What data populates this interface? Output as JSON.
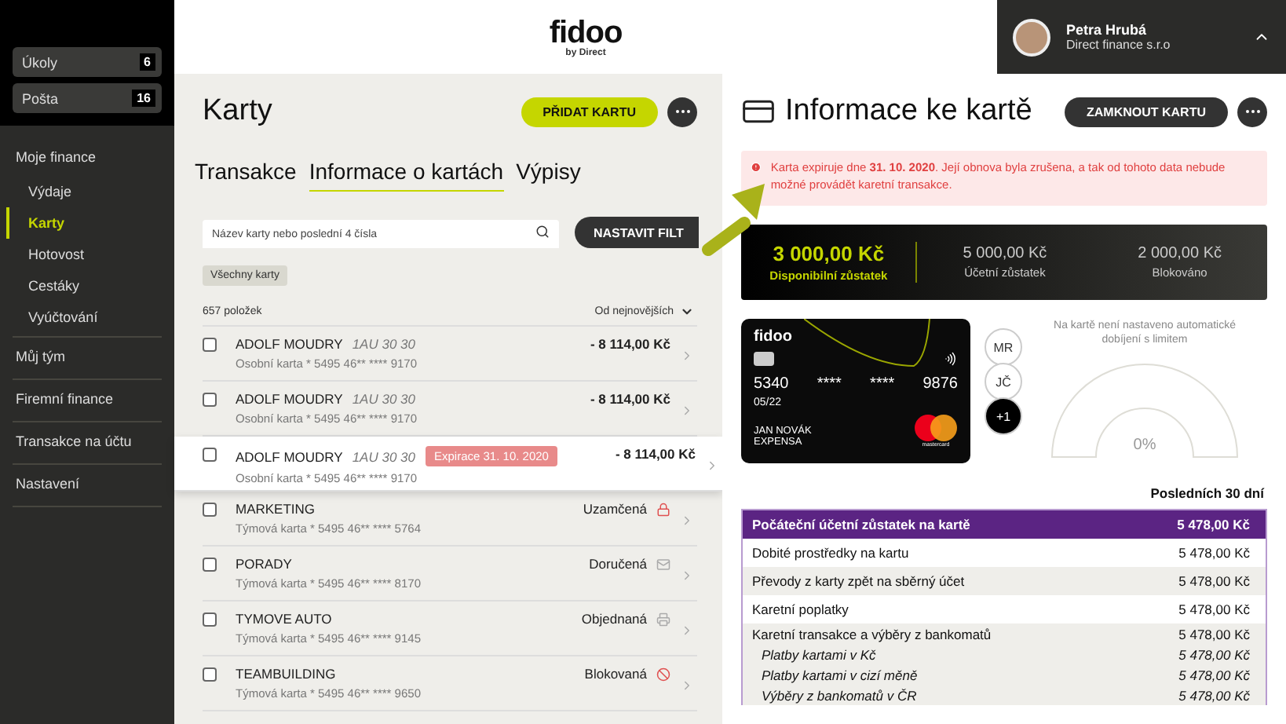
{
  "sidebar": {
    "counters": [
      {
        "label": "Úkoly",
        "count": "6"
      },
      {
        "label": "Pošta",
        "count": "16"
      }
    ],
    "items": [
      {
        "label": "Moje finance",
        "selected": false,
        "children": [
          {
            "label": "Výdaje",
            "selected": false
          },
          {
            "label": "Karty",
            "selected": true
          },
          {
            "label": "Hotovost",
            "selected": false
          },
          {
            "label": "Cestáky",
            "selected": false
          },
          {
            "label": "Vyúčtování",
            "selected": false
          }
        ]
      },
      {
        "label": "Můj tým",
        "selected": false
      },
      {
        "label": "Firemní finance",
        "selected": false
      },
      {
        "label": "Transakce na účtu",
        "selected": false
      },
      {
        "label": "Nastavení",
        "selected": false
      }
    ]
  },
  "header": {
    "logo": "fidoo",
    "logo_sub": "by Direct",
    "user": {
      "name": "Petra Hrubá",
      "company": "Direct finance s.r.o"
    }
  },
  "cards_panel": {
    "title": "Karty",
    "add_button": "PŘIDAT KARTU",
    "tabs": [
      {
        "label": "Transakce",
        "selected": false
      },
      {
        "label": "Informace o kartách",
        "selected": true
      },
      {
        "label": "Výpisy",
        "selected": false
      }
    ],
    "search": {
      "placeholder": "Název karty nebo poslední 4 čísla"
    },
    "filter_button": "NASTAVIT FILT",
    "chip": "Všechny karty",
    "count": "657 položek",
    "sort": "Od nejnovějších",
    "rows": [
      {
        "name": "ADOLF MOUDRY",
        "code": "1AU 30 30",
        "detail": "Osobní karta * 5495 46** **** 9170",
        "value": "- 8 114,00 Kč",
        "kind": "amount",
        "checked": false,
        "selected": false
      },
      {
        "name": "ADOLF MOUDRY",
        "code": "1AU 30 30",
        "detail": "Osobní karta * 5495 46** **** 9170",
        "value": "- 8 114,00 Kč",
        "kind": "amount",
        "checked": false,
        "selected": false
      },
      {
        "name": "ADOLF MOUDRY",
        "code": "1AU 30 30",
        "badge": "Expirace 31. 10. 2020",
        "detail": "Osobní karta * 5495 46** **** 9170",
        "value": "- 8 114,00 Kč",
        "kind": "amount",
        "checked": false,
        "selected": true
      },
      {
        "name": "MARKETING",
        "detail": "Týmová karta * 5495 46** **** 5764",
        "value": "Uzamčená",
        "kind": "locked",
        "checked": false,
        "selected": false
      },
      {
        "name": "PORADY",
        "detail": "Týmová karta * 5495 46** **** 8170",
        "value": "Doručená",
        "kind": "delivered",
        "checked": false,
        "selected": false
      },
      {
        "name": "TYMOVE AUTO",
        "detail": "Týmová karta * 5495 46** **** 9145",
        "value": "Objednaná",
        "kind": "ordered",
        "checked": false,
        "selected": false
      },
      {
        "name": "TEAMBUILDING",
        "detail": "Týmová karta * 5495 46** **** 9650",
        "value": "Blokovaná",
        "kind": "blocked",
        "checked": false,
        "selected": false
      }
    ]
  },
  "detail_panel": {
    "title": "Informace ke kartě",
    "lock_button": "ZAMKNOUT KARTU",
    "alert": "Karta expiruje dne **31. 10. 2020**. Její obnova byla zrušena, a tak od tohoto data nebude možné provádět karetní transakce.",
    "balances": [
      {
        "amount": "3 000,00 Kč",
        "label": "Disponibilní zůstatek",
        "kind": "main"
      },
      {
        "amount": "5 000,00 Kč",
        "label": "Účetní zůstatek",
        "kind": "other"
      },
      {
        "amount": "2 000,00 Kč",
        "label": "Blokováno",
        "kind": "other"
      }
    ],
    "card": {
      "brand": "fidoo",
      "number": [
        "5340",
        "****",
        "****",
        "9876"
      ],
      "expiry": "05/22",
      "holder": "JAN NOVÁK",
      "company": "EXPENSA",
      "network": "mastercard"
    },
    "holders": [
      {
        "label": "MR",
        "kind": "light"
      },
      {
        "label": "JČ",
        "kind": "light"
      },
      {
        "label": "+1",
        "kind": "dark"
      }
    ],
    "topup": {
      "note": "Na kartě není nastaveno automatické dobíjení s limitem",
      "reading": "0%"
    },
    "period": "Posledních 30 dní",
    "table": [
      {
        "label": "Počáteční účetní zůstatek na kartě",
        "value": "5 478,00 Kč",
        "kind": "header"
      },
      {
        "label": "Dobité prostředky na kartu",
        "value": "5 478,00 Kč",
        "kind": "row"
      },
      {
        "label": "Převody z karty zpět na sběrný účet",
        "value": "5 478,00 Kč",
        "kind": "row"
      },
      {
        "label": "Karetní poplatky",
        "value": "5 478,00 Kč",
        "kind": "row"
      },
      {
        "label": "Karetní transakce a výběry z bankomatů",
        "value": "5 478,00 Kč",
        "kind": "group"
      },
      {
        "label": "Platby kartami v Kč",
        "value": "5 478,00 Kč",
        "kind": "sub"
      },
      {
        "label": "Platby kartami v cizí měně",
        "value": "5 478,00 Kč",
        "kind": "sub"
      },
      {
        "label": "Výběry z bankomatů v ČR",
        "value": "5 478,00 Kč",
        "kind": "sub"
      }
    ]
  }
}
